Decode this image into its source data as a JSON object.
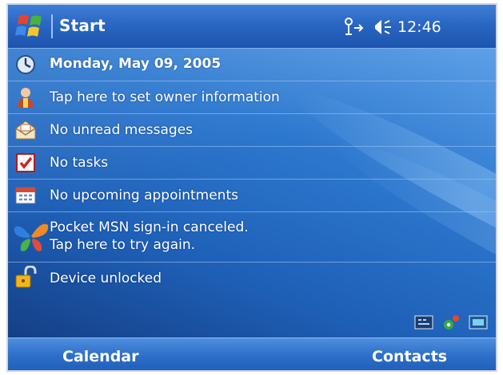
{
  "title_bar": {
    "title": "Start",
    "clock": "12:46",
    "icons": [
      "windows-flag-icon",
      "antenna-icon",
      "speaker-icon"
    ]
  },
  "today": {
    "items": [
      {
        "label": "Monday, May 09, 2005",
        "icon": "clock-icon"
      },
      {
        "label": "Tap here to set owner information",
        "icon": "owner-icon"
      },
      {
        "label": "No unread messages",
        "icon": "envelope-icon"
      },
      {
        "label": "No tasks",
        "icon": "tasks-icon"
      },
      {
        "label": "No upcoming appointments",
        "icon": "calendar-icon"
      },
      {
        "label_line1": "Pocket MSN sign-in canceled.",
        "label_line2": "Tap here to try again.",
        "icon": "msn-butterfly-icon"
      },
      {
        "label": "Device unlocked",
        "icon": "unlocked-padlock-icon"
      }
    ],
    "tray_icons": [
      "keyboard-icon",
      "connectivity-icon",
      "display-icon"
    ]
  },
  "softkeys": {
    "left": "Calendar",
    "right": "Contacts"
  },
  "colors": {
    "title_bar": "#2a66c3",
    "background": "#1e5fb6",
    "text": "#ffffff"
  }
}
